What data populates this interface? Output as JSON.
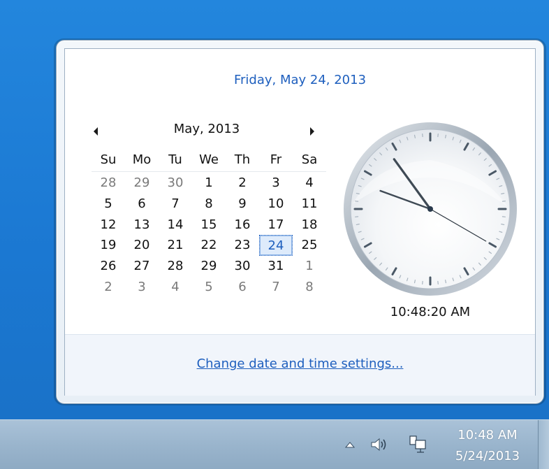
{
  "flyout": {
    "date_header": "Friday, May 24, 2013",
    "calendar": {
      "month_title": "May, 2013",
      "weekdays": [
        "Su",
        "Mo",
        "Tu",
        "We",
        "Th",
        "Fr",
        "Sa"
      ],
      "weeks": [
        [
          {
            "d": "28",
            "other": true
          },
          {
            "d": "29",
            "other": true
          },
          {
            "d": "30",
            "other": true
          },
          {
            "d": "1"
          },
          {
            "d": "2"
          },
          {
            "d": "3"
          },
          {
            "d": "4"
          }
        ],
        [
          {
            "d": "5"
          },
          {
            "d": "6"
          },
          {
            "d": "7"
          },
          {
            "d": "8"
          },
          {
            "d": "9"
          },
          {
            "d": "10"
          },
          {
            "d": "11"
          }
        ],
        [
          {
            "d": "12"
          },
          {
            "d": "13"
          },
          {
            "d": "14"
          },
          {
            "d": "15"
          },
          {
            "d": "16"
          },
          {
            "d": "17"
          },
          {
            "d": "18"
          }
        ],
        [
          {
            "d": "19"
          },
          {
            "d": "20"
          },
          {
            "d": "21"
          },
          {
            "d": "22"
          },
          {
            "d": "23"
          },
          {
            "d": "24",
            "today": true
          },
          {
            "d": "25"
          }
        ],
        [
          {
            "d": "26"
          },
          {
            "d": "27"
          },
          {
            "d": "28"
          },
          {
            "d": "29"
          },
          {
            "d": "30"
          },
          {
            "d": "31"
          },
          {
            "d": "1",
            "other": true
          }
        ],
        [
          {
            "d": "2",
            "other": true
          },
          {
            "d": "3",
            "other": true
          },
          {
            "d": "4",
            "other": true
          },
          {
            "d": "5",
            "other": true
          },
          {
            "d": "6",
            "other": true
          },
          {
            "d": "7",
            "other": true
          },
          {
            "d": "8",
            "other": true
          }
        ]
      ],
      "prev_icon": "triangle-left-icon",
      "next_icon": "triangle-right-icon"
    },
    "clock": {
      "time_text": "10:48:20 AM",
      "hour": 10,
      "minute": 48,
      "second": 20
    },
    "settings_link": "Change date and time settings..."
  },
  "taskbar": {
    "tray_time": "10:48 AM",
    "tray_date": "5/24/2013",
    "icons": [
      "show-hidden-icons-icon",
      "volume-icon",
      "network-icon"
    ]
  },
  "colors": {
    "accent": "#1e5fbe",
    "desktop": "#1f7ad1",
    "today_bg": "#deebfb"
  }
}
